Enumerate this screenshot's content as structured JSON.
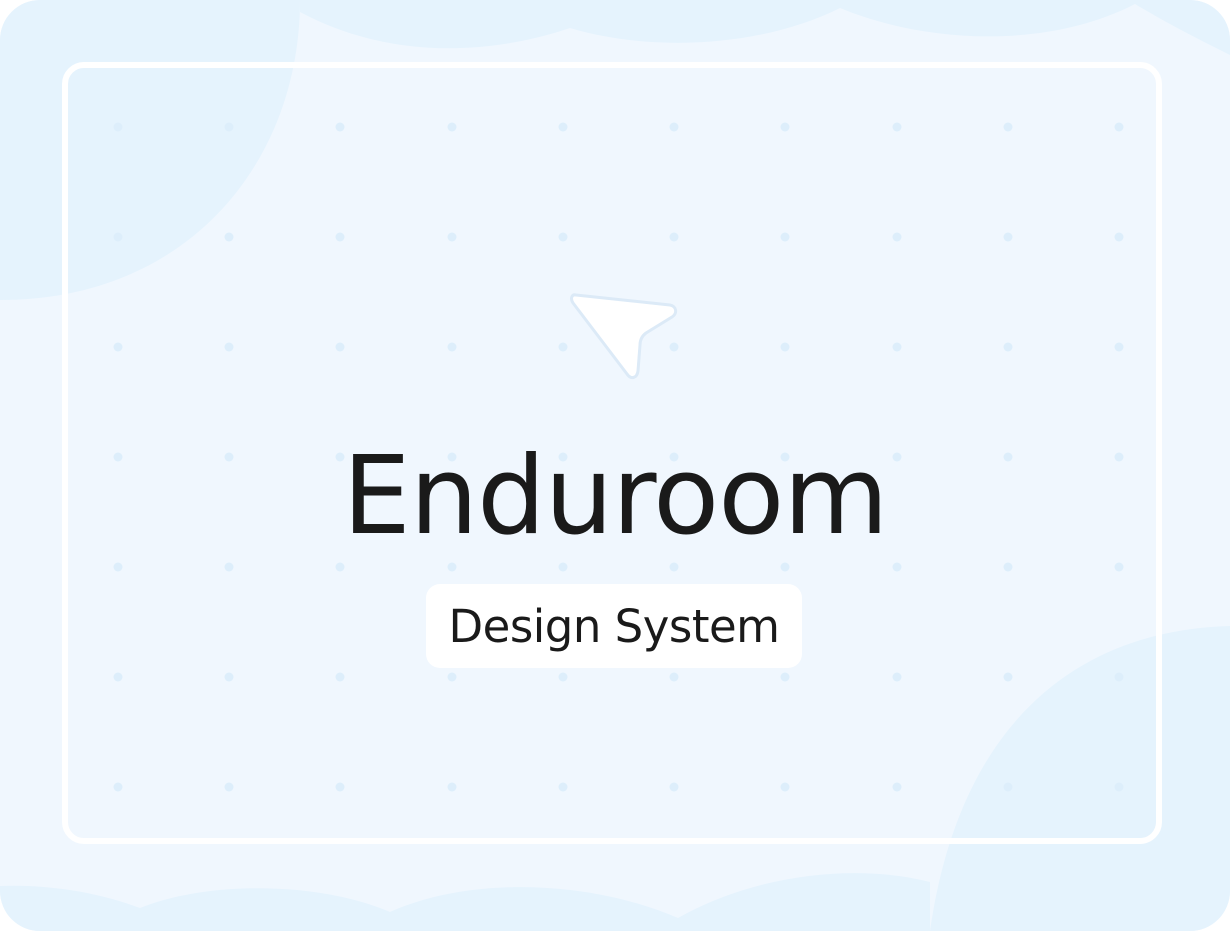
{
  "brand": {
    "title": "Enduroom",
    "subtitle": "Design System"
  },
  "icons": {
    "pointer": "cursor-arrow-icon"
  },
  "colors": {
    "background": "#f0f7fe",
    "shape": "#e5f3fd",
    "dot": "#ddeefb",
    "frame": "#ffffff",
    "text": "#1a1a1a"
  }
}
